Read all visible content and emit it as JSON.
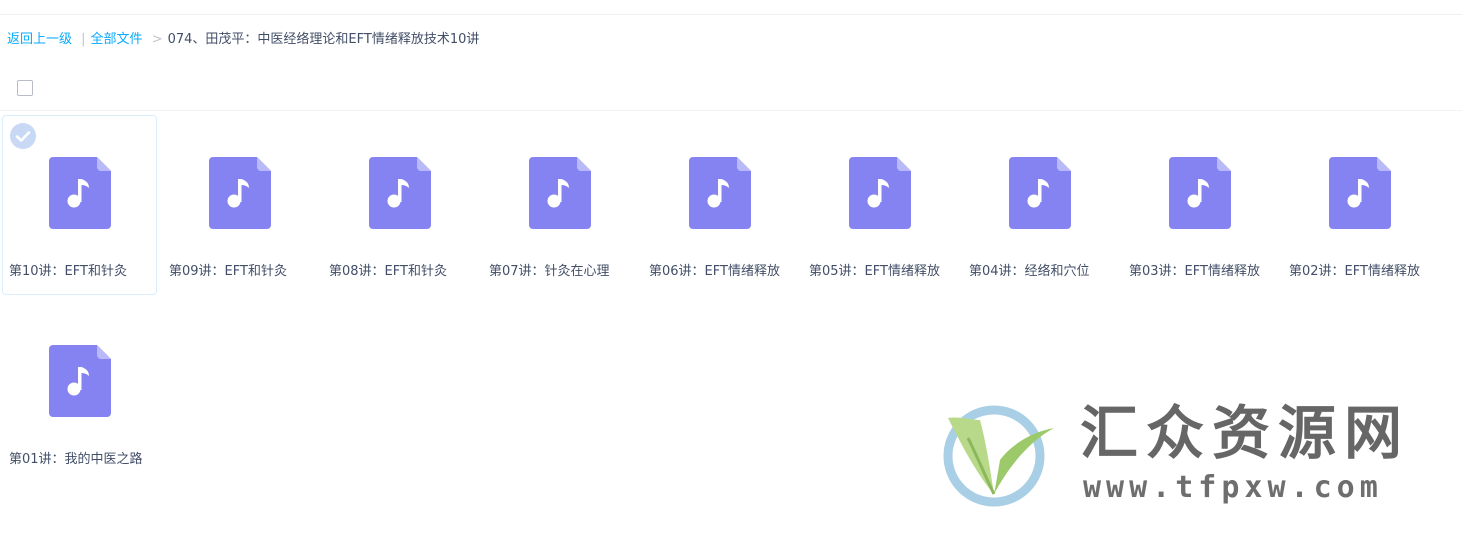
{
  "breadcrumb": {
    "back": "返回上一级",
    "divider": "|",
    "all_files": "全部文件",
    "arrow": ">",
    "current": "074、田茂平：中医经络理论和EFT情绪释放技术10讲"
  },
  "files": [
    {
      "name": "第10讲：EFT和针灸",
      "selected": true
    },
    {
      "name": "第09讲：EFT和针灸",
      "selected": false
    },
    {
      "name": "第08讲：EFT和针灸",
      "selected": false
    },
    {
      "name": "第07讲：针灸在心理",
      "selected": false
    },
    {
      "name": "第06讲：EFT情绪释放",
      "selected": false
    },
    {
      "name": "第05讲：EFT情绪释放",
      "selected": false
    },
    {
      "name": "第04讲：经络和穴位",
      "selected": false
    },
    {
      "name": "第03讲：EFT情绪释放",
      "selected": false
    },
    {
      "name": "第02讲：EFT情绪释放",
      "selected": false
    },
    {
      "name": "第01讲：我的中医之路",
      "selected": false
    }
  ],
  "watermark": {
    "title": "汇众资源网",
    "url": "www.tfpxw.com"
  },
  "colors": {
    "link": "#09aaff",
    "file_icon": "#8583f2",
    "file_icon_fold": "#b9b8f8",
    "selected_border": "#d9eefb",
    "check_badge": "#c7d9f5"
  },
  "icons": {
    "file_type": "music-file-icon",
    "selected": "check-circle-icon"
  }
}
